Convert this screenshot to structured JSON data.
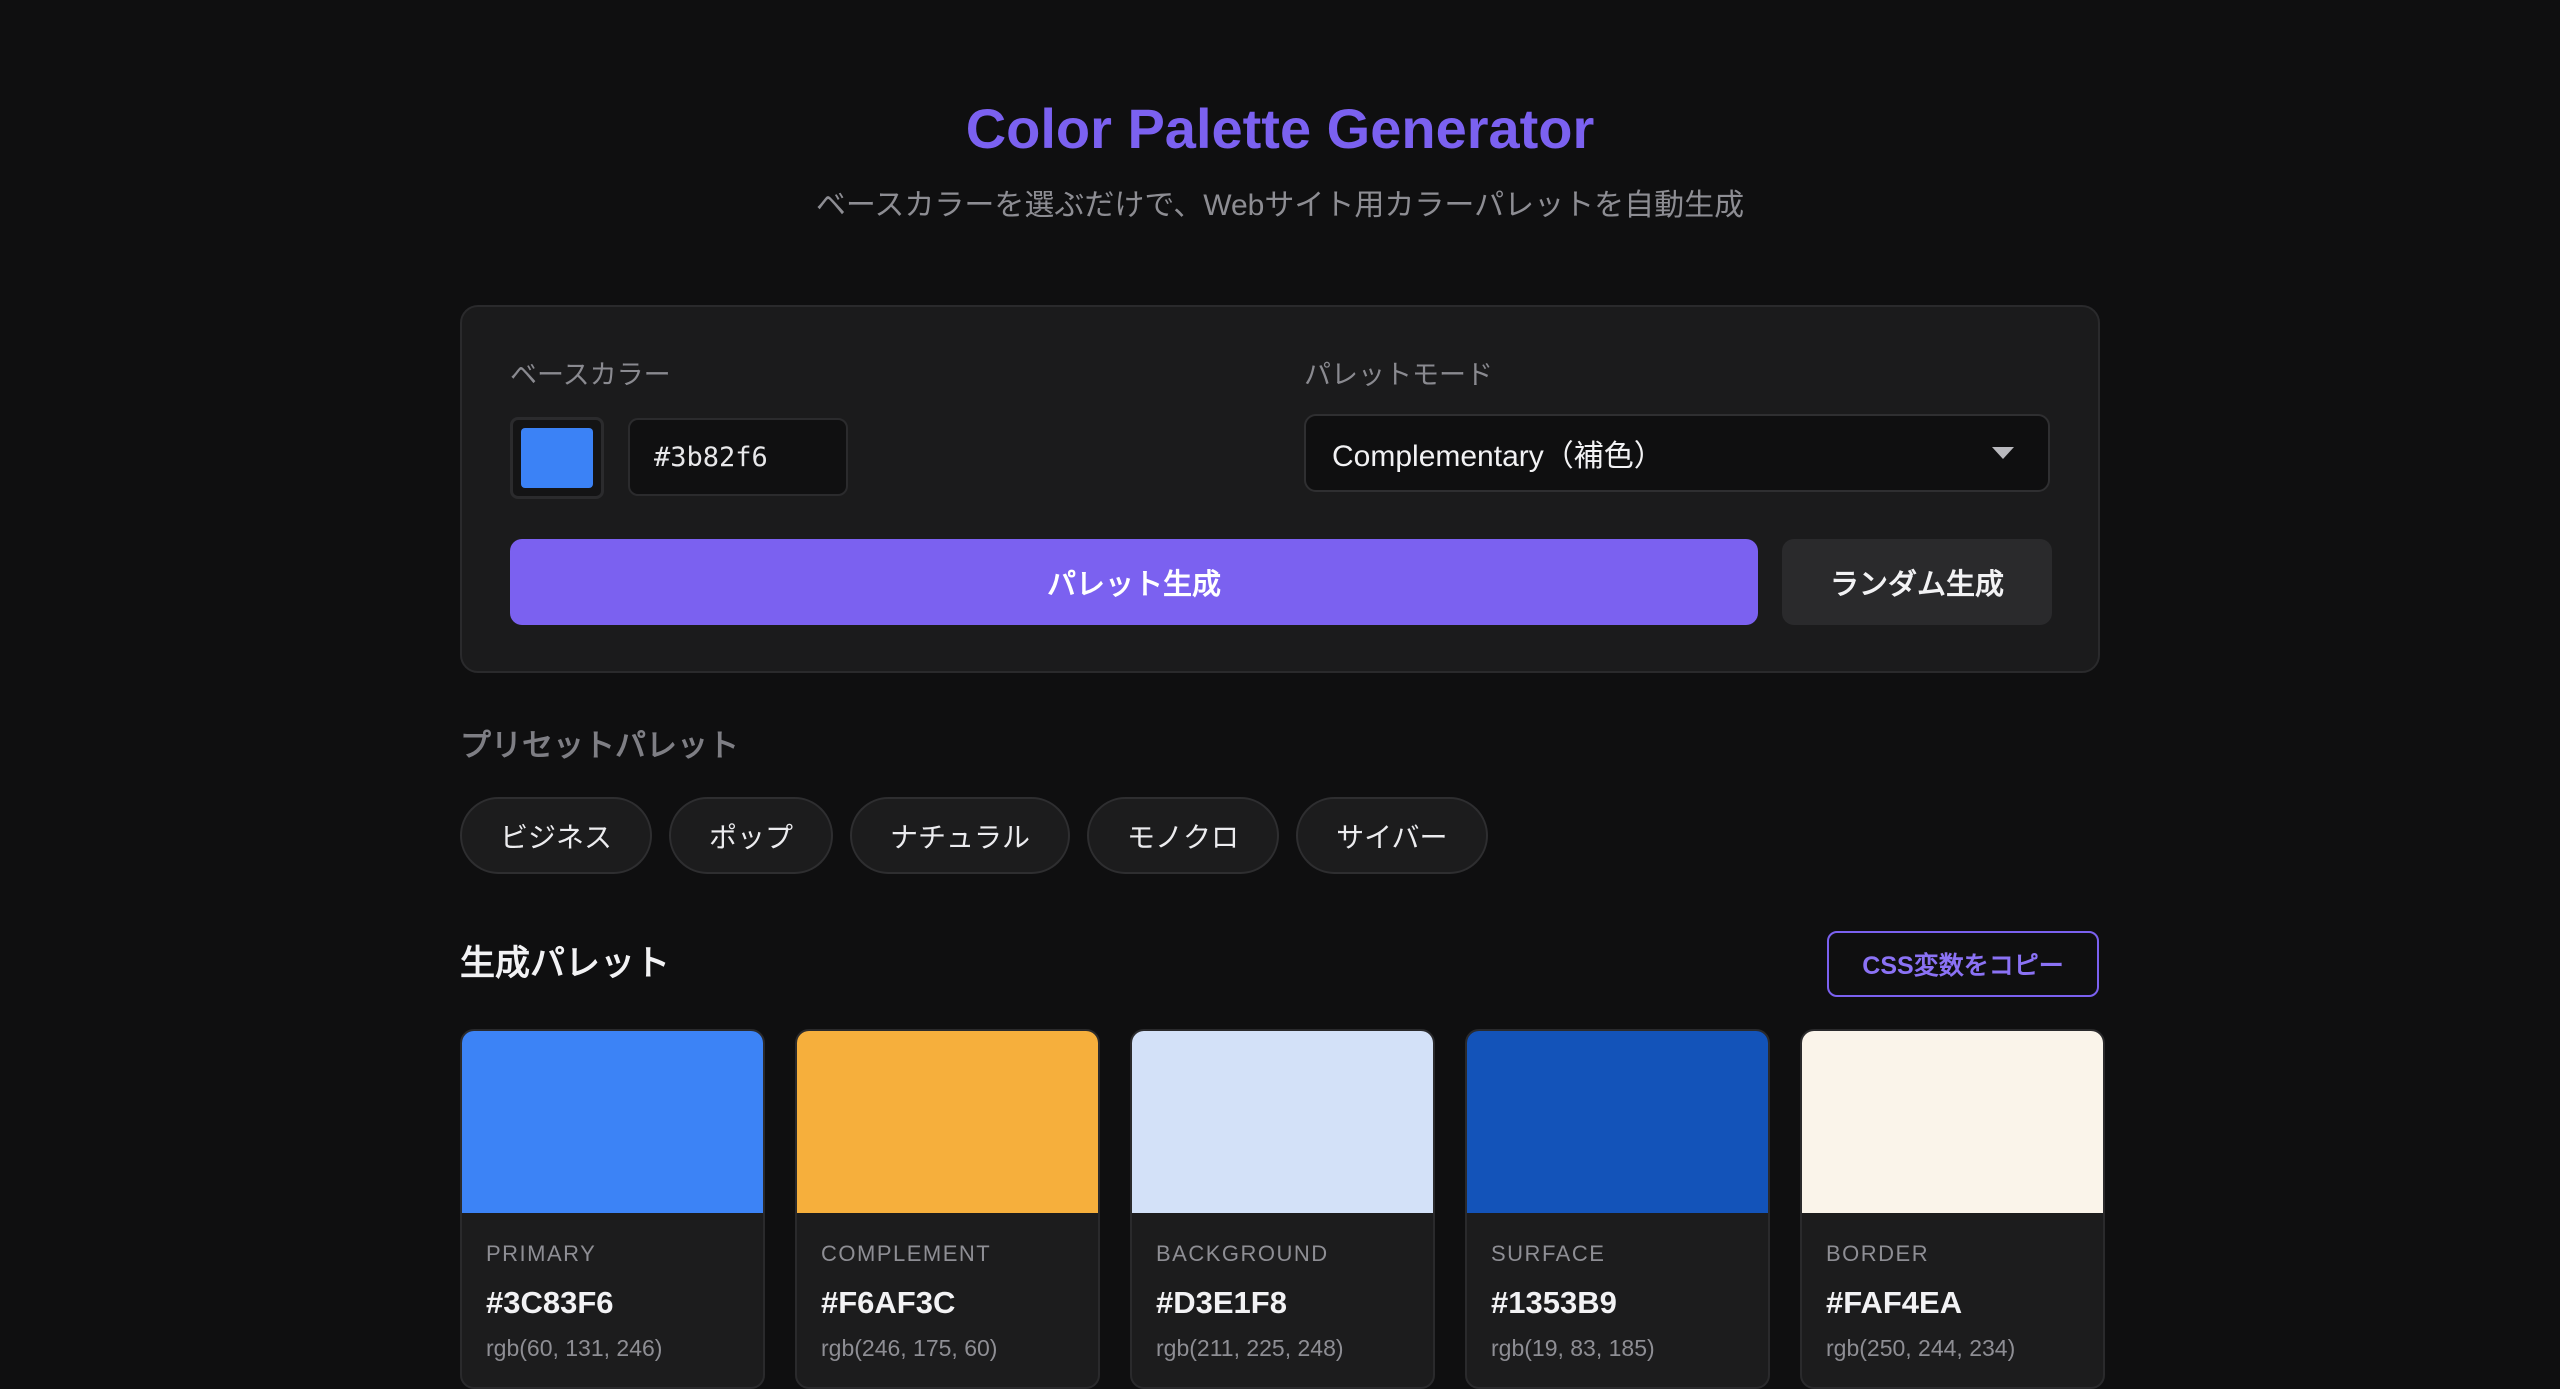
{
  "header": {
    "title": "Color Palette Generator",
    "subtitle": "ベースカラーを選ぶだけで、Webサイト用カラーパレットを自動生成"
  },
  "controls": {
    "base_color_label": "ベースカラー",
    "base_color_value": "#3b82f6",
    "palette_mode_label": "パレットモード",
    "palette_mode_value": "Complementary（補色）",
    "generate_label": "パレット生成",
    "random_label": "ランダム生成"
  },
  "presets": {
    "heading": "プリセットパレット",
    "items": [
      "ビジネス",
      "ポップ",
      "ナチュラル",
      "モノクロ",
      "サイバー"
    ]
  },
  "palette": {
    "heading": "生成パレット",
    "copy_label": "CSS変数をコピー",
    "cards": [
      {
        "role": "PRIMARY",
        "hex": "#3C83F6",
        "rgb": "rgb(60, 131, 246)",
        "color": "#3C83F6"
      },
      {
        "role": "COMPLEMENT",
        "hex": "#F6AF3C",
        "rgb": "rgb(246, 175, 60)",
        "color": "#F6AF3C"
      },
      {
        "role": "BACKGROUND",
        "hex": "#D3E1F8",
        "rgb": "rgb(211, 225, 248)",
        "color": "#D3E1F8"
      },
      {
        "role": "SURFACE",
        "hex": "#1353B9",
        "rgb": "rgb(19, 83, 185)",
        "color": "#1353B9"
      },
      {
        "role": "BORDER",
        "hex": "#FAF4EA",
        "rgb": "rgb(250, 244, 234)",
        "color": "#FAF4EA"
      }
    ]
  },
  "colors": {
    "accent": "#7b61f0",
    "background": "#0f0f10",
    "panel": "#1b1b1c"
  }
}
